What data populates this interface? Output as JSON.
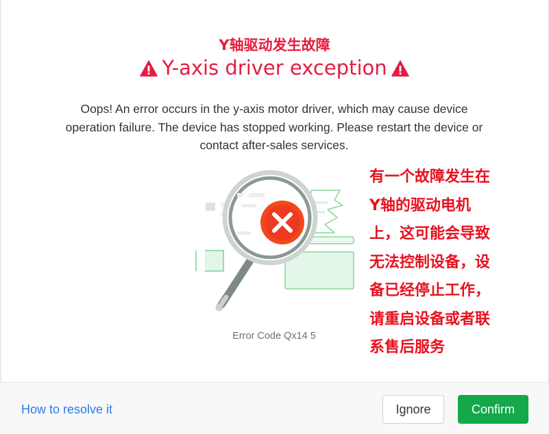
{
  "dialog": {
    "title_cn": "Y轴驱动发生故障",
    "title_en": "Y-axis driver exception",
    "warning_icon": "warning-triangle-icon",
    "description": "Oops! An error occurs in the y-axis motor driver, which may cause device operation failure. The device has stopped working. Please restart the device or contact after-sales services.",
    "error_code": "Error Code Qx14 5",
    "illustration_icon": "magnifier-error-icon"
  },
  "annotation": {
    "lines": [
      "有一个故障发生在",
      "Y轴的驱动电机",
      "上，这可能会导致",
      "无法控制设备，设",
      "备已经停止工作，",
      "请重启设备或者联",
      "系售后服务"
    ]
  },
  "footer": {
    "resolve_link": "How to resolve it",
    "ignore_label": "Ignore",
    "confirm_label": "Confirm"
  },
  "colors": {
    "title": "#e31c44",
    "annotation": "#e8111f",
    "link": "#2b7de9",
    "confirm": "#14a84a",
    "error_badge": "#f04a1a"
  }
}
